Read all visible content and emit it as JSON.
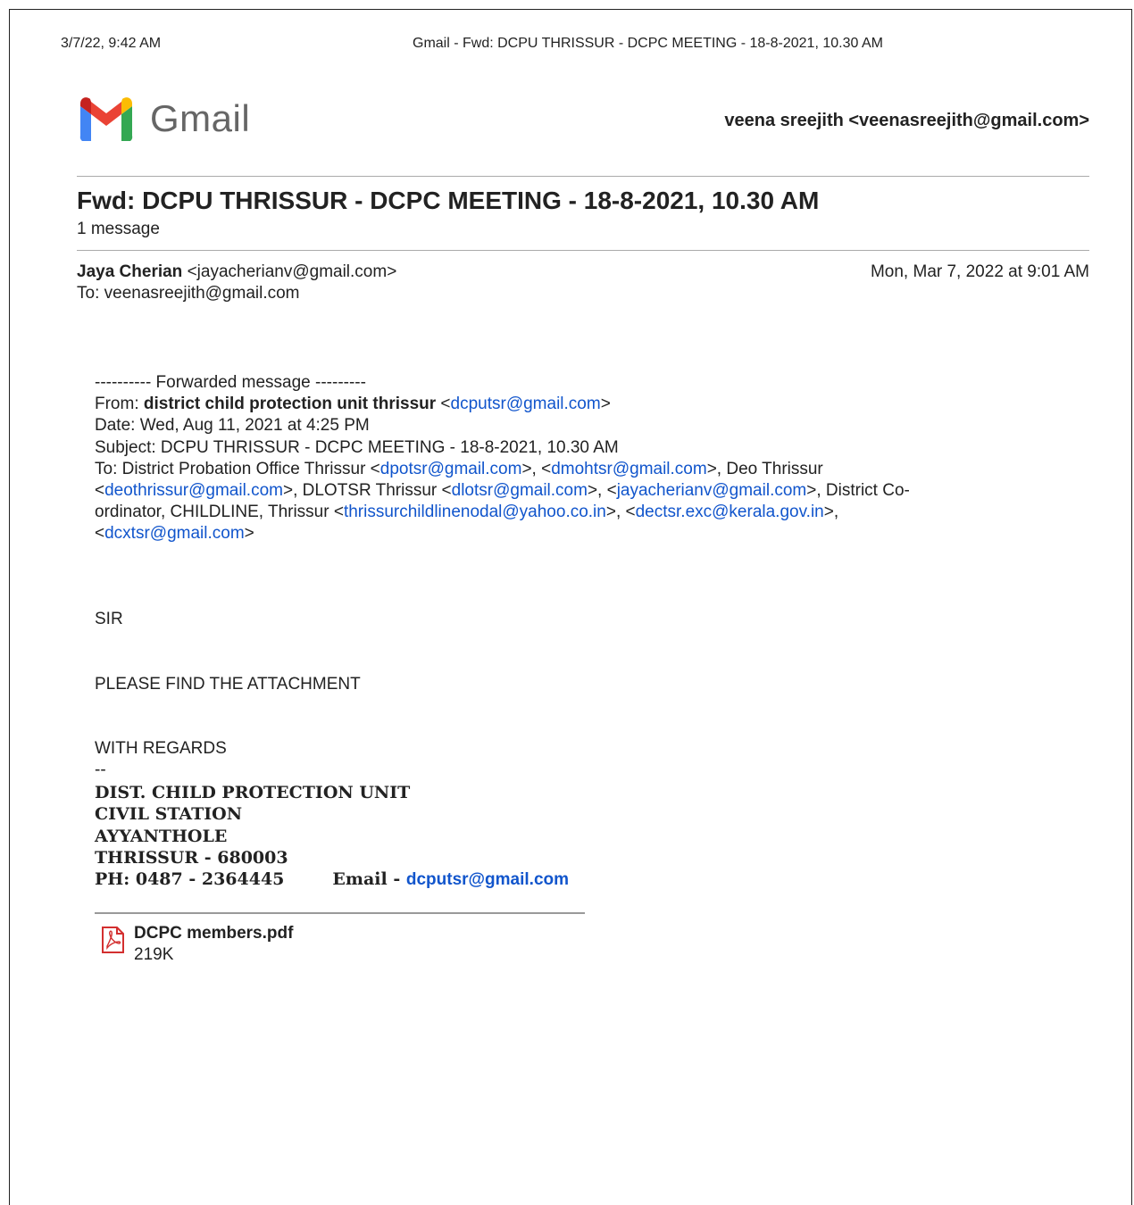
{
  "print_header": {
    "date": "3/7/22, 9:42 AM",
    "title": "Gmail - Fwd: DCPU THRISSUR - DCPC MEETING - 18-8-2021, 10.30 AM"
  },
  "logo": {
    "wordmark": "Gmail",
    "icon": "gmail-m-logo"
  },
  "account": "veena sreejith <veenasreejith@gmail.com>",
  "thread": {
    "subject": "Fwd: DCPU THRISSUR - DCPC MEETING - 18-8-2021, 10.30 AM",
    "count": "1 message"
  },
  "message": {
    "from_name": "Jaya Cherian",
    "from_email": " <jayacherianv@gmail.com>",
    "to": "To: veenasreejith@gmail.com",
    "date": "Mon, Mar 7, 2022 at 9:01 AM"
  },
  "forwarded": {
    "header": "---------- Forwarded message ---------",
    "from_label": "From: ",
    "from_name": "district child protection unit thrissur",
    "from_email": "dcputsr@gmail.com",
    "date": "Date: Wed, Aug 11, 2021 at 4:25 PM",
    "subject": "Subject: DCPU THRISSUR - DCPC MEETING - 18-8-2021, 10.30 AM",
    "to_label": "To: District Probation Office Thrissur <",
    "to1": "dpotsr@gmail.com",
    "to2": "dmohtsr@gmail.com",
    "to3_text": ">, Deo Thrissur",
    "to3": "deothrissur@gmail.com",
    "to4_text": ">, DLOTSR Thrissur <",
    "to4": "dlotsr@gmail.com",
    "to5": "jayacherianv@gmail.com",
    "to6_text_a": ">, District Co-",
    "to6_text_b": "ordinator, CHILDLINE, Thrissur <",
    "to6": "thrissurchildlinenodal@yahoo.co.in",
    "to7": "dectsr.exc@kerala.gov.in",
    "to8": "dcxtsr@gmail.com"
  },
  "body": {
    "salutation": "SIR",
    "line1": "PLEASE FIND THE ATTACHMENT",
    "closing": "WITH REGARDS",
    "sig_sep": "--"
  },
  "signature": {
    "line1": "DIST. CHILD PROTECTION UNIT",
    "line2": "CIVIL STATION",
    "line3": "AYYANTHOLE",
    "line4": "THRISSUR - 680003",
    "phone": "PH: 0487 - 2364445",
    "email_label": "Email - ",
    "email": "dcputsr@gmail.com"
  },
  "attachment": {
    "icon": "pdf-file-icon",
    "name": "DCPC members.pdf",
    "size": "219K"
  },
  "colors": {
    "link": "#1155cc",
    "pdf_red": "#d32f2f"
  }
}
